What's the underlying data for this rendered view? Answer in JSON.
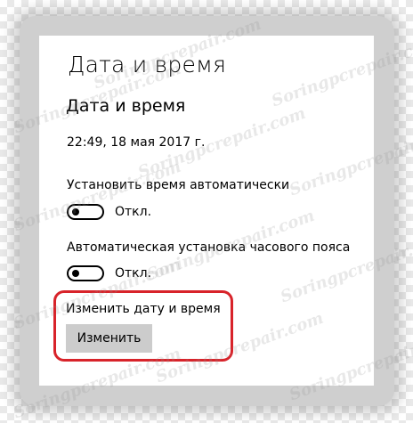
{
  "window": {
    "title": "Дата и время"
  },
  "section": {
    "title": "Дата и время",
    "current_datetime": "22:49, 18 мая 2017 г."
  },
  "auto_time": {
    "label": "Установить время автоматически",
    "state_label": "Откл.",
    "on": false
  },
  "auto_timezone": {
    "label": "Автоматическая установка часового пояса",
    "state_label": "Откл.",
    "on": false
  },
  "change_datetime": {
    "label": "Изменить дату и время",
    "button_label": "Изменить"
  },
  "watermark": {
    "text": "Soringpcrepair.com"
  },
  "colors": {
    "highlight": "#d8232a",
    "button_bg": "#cccccc",
    "panel_bg": "#ffffff"
  }
}
